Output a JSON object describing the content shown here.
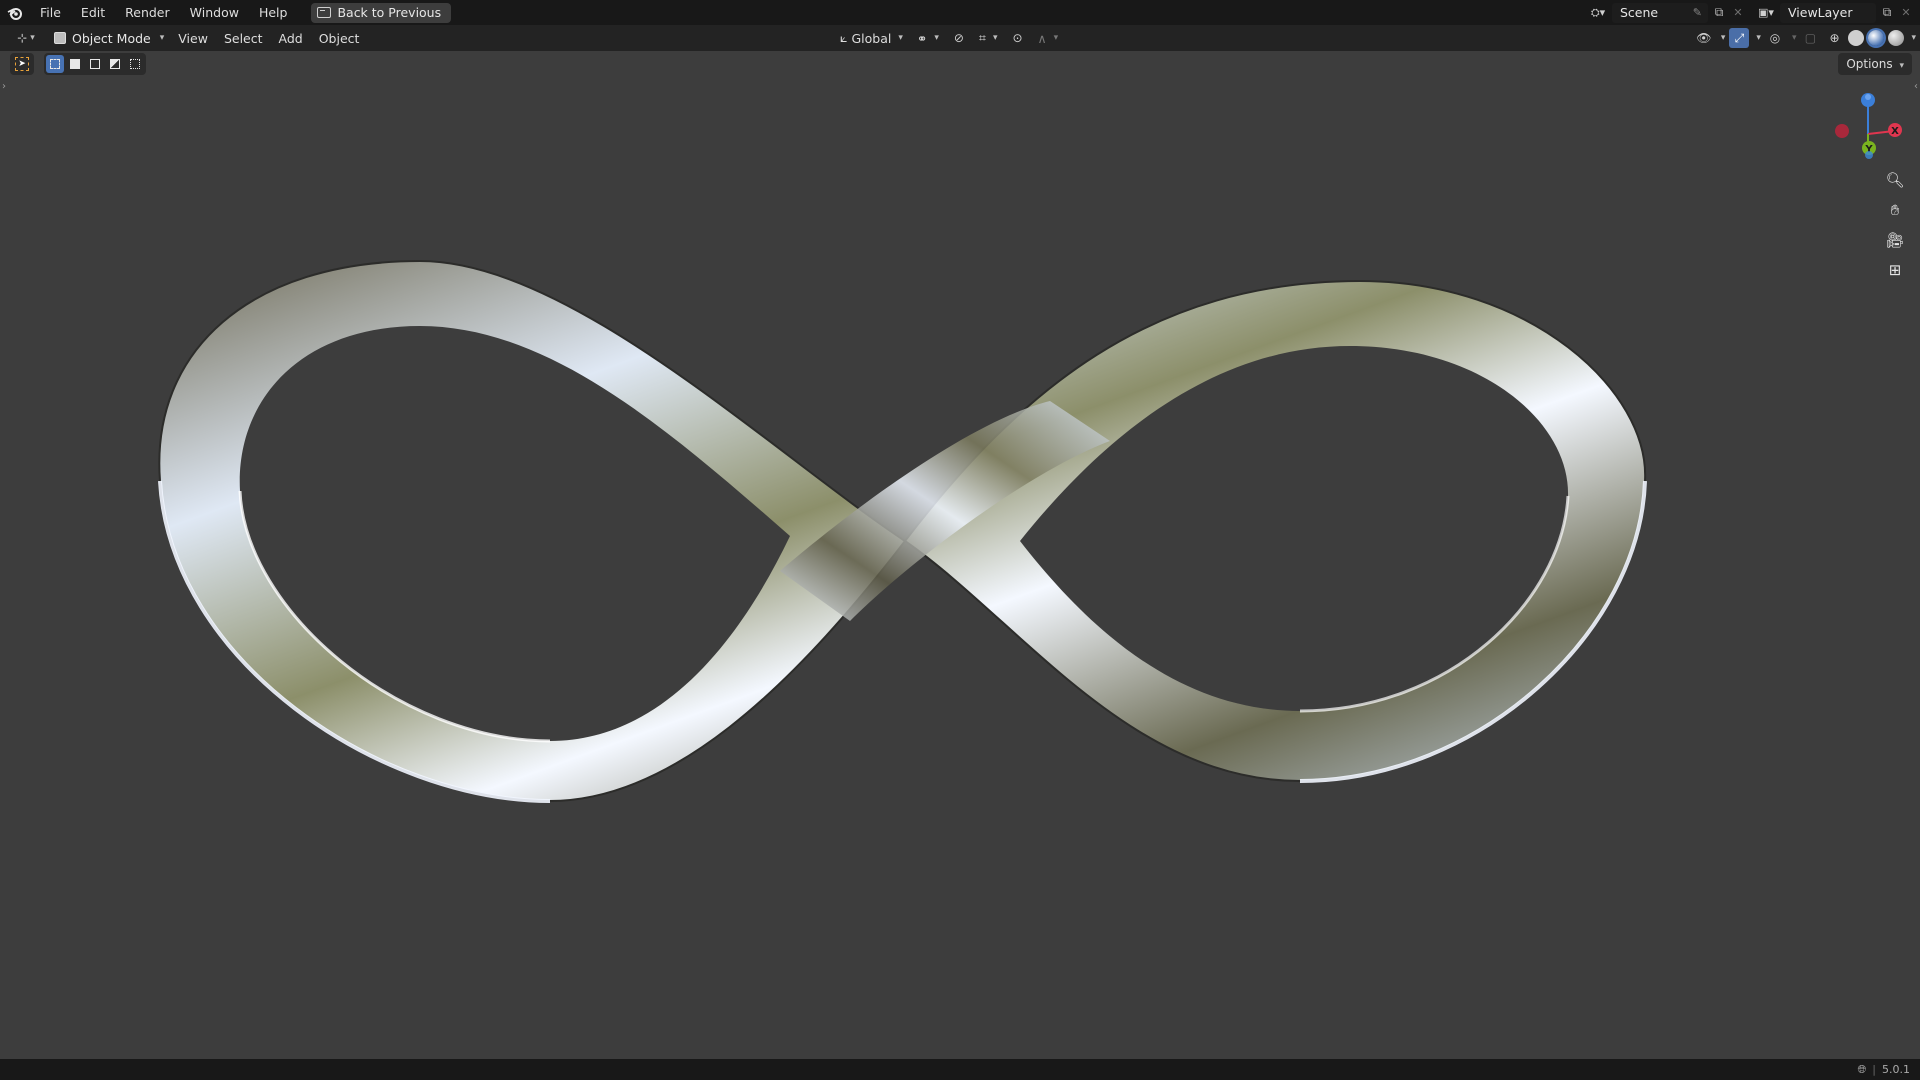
{
  "topbar": {
    "menus": [
      "File",
      "Edit",
      "Render",
      "Window",
      "Help"
    ],
    "back_label": "Back to Previous",
    "scene_name": "Scene",
    "view_layer": "ViewLayer"
  },
  "header": {
    "mode": "Object Mode",
    "menus": [
      "View",
      "Select",
      "Add",
      "Object"
    ],
    "orientation": "Global"
  },
  "viewport": {
    "options_label": "Options",
    "gizmo": {
      "x_label": "X",
      "y_label": "Y"
    }
  },
  "statusbar": {
    "version": "5.0.1"
  },
  "colors": {
    "viewport_bg": "#3d3d3d",
    "accent": "#4772b3",
    "axis_x": "#e0364f",
    "axis_y": "#7ab31f",
    "axis_z": "#3b7fd9"
  },
  "icons": [
    "blender-logo-icon",
    "back-icon",
    "scene-icon",
    "pin-icon",
    "view-layer-icon",
    "zoom-icon",
    "hand-pan-icon",
    "camera-icon",
    "grid-icon",
    "cursor-tool-icon"
  ]
}
